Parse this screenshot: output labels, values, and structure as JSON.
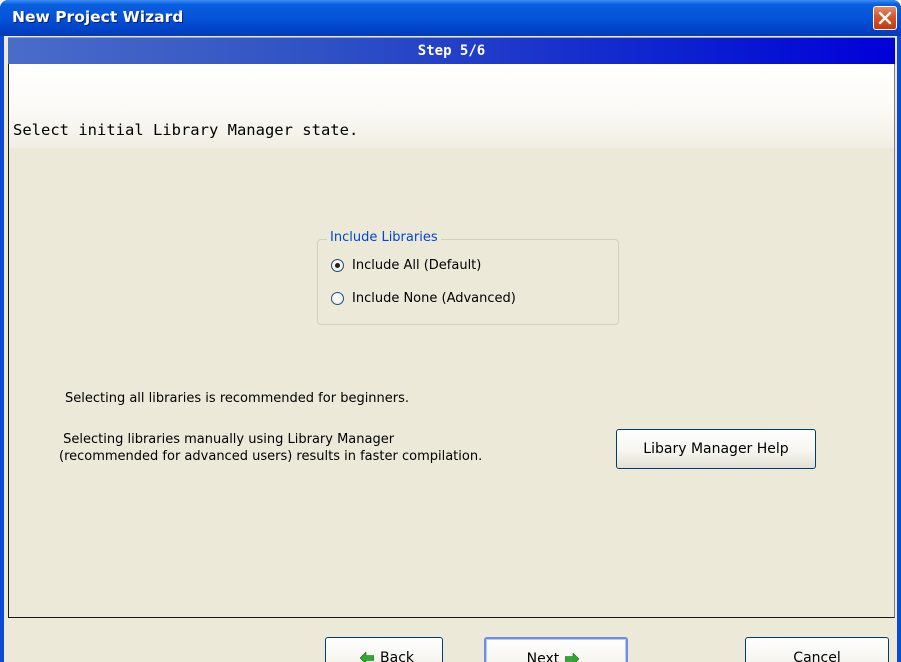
{
  "window": {
    "title": "New Project Wizard",
    "close_icon": "close-icon"
  },
  "step": {
    "label": "Step 5/6"
  },
  "header": {
    "text": "Select initial Library Manager state."
  },
  "libraries": {
    "group_label": "Include Libraries",
    "options": [
      {
        "label": "Include All (Default)",
        "selected": true
      },
      {
        "label": "Include None (Advanced)",
        "selected": false
      }
    ]
  },
  "info": {
    "line1": "Selecting all libraries is recommended for beginners.",
    "line2": " Selecting libraries manually using Library Manager\n(recommended for advanced users) results in faster compilation."
  },
  "help_button": {
    "label": "Libary Manager Help"
  },
  "footer": {
    "back": {
      "mnemonic": "B",
      "rest": "ack"
    },
    "next": {
      "mnemonic": "N",
      "rest": "ext"
    },
    "cancel": {
      "mnemonic": "C",
      "rest": "ancel"
    }
  },
  "colors": {
    "titlebar": "#0453d8",
    "step_bar_end": "#0000d8",
    "client_bg": "#ece9d8",
    "group_label": "#0046d5",
    "arrow_green": "#2ea82e"
  }
}
